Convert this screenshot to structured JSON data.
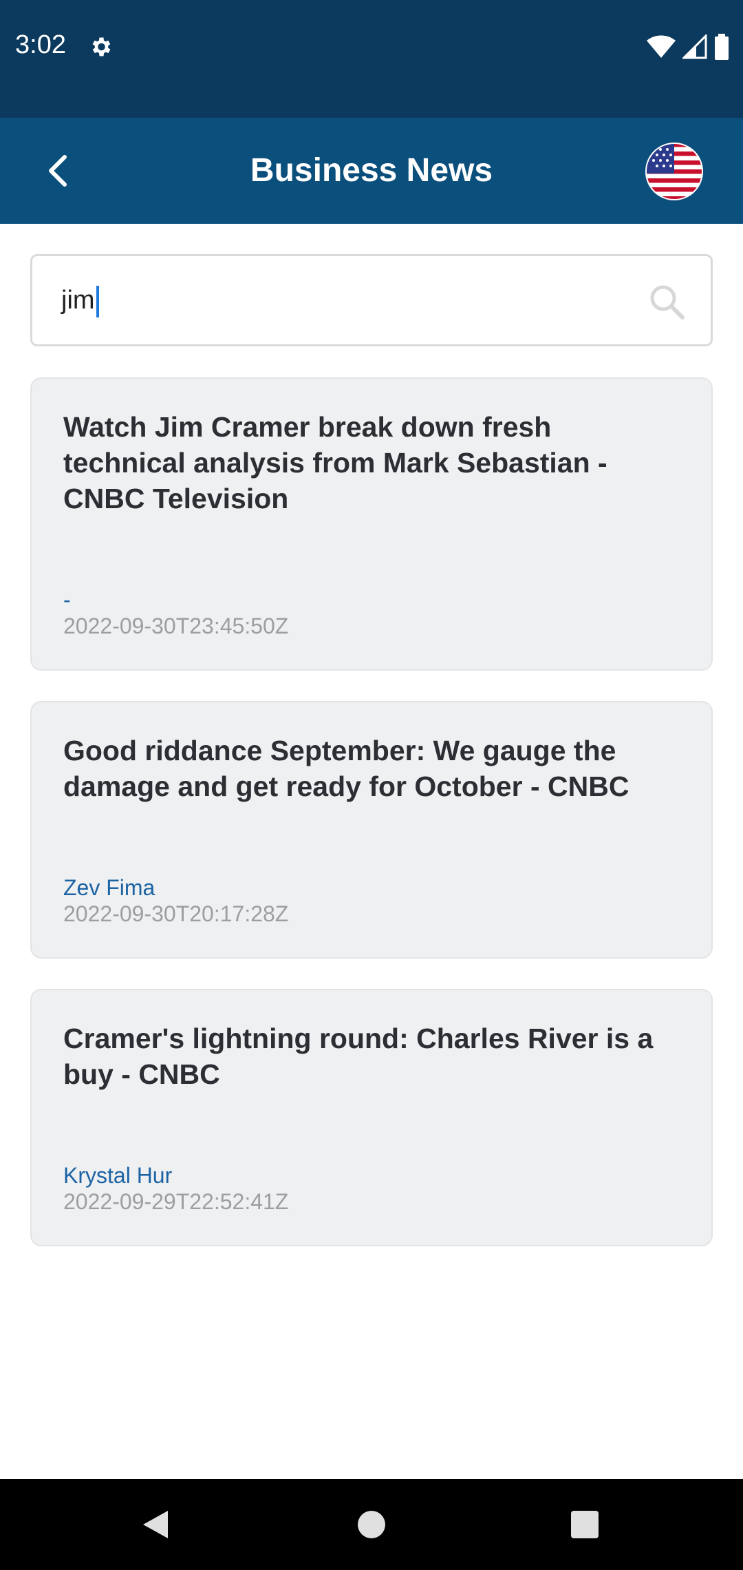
{
  "status_bar": {
    "time": "3:02",
    "left_icons": [
      "gear-icon"
    ],
    "right_icons": [
      "wifi-icon",
      "cellular-signal-icon",
      "battery-icon"
    ]
  },
  "app_bar": {
    "title": "Business News",
    "back_icon": "back-arrow-icon",
    "region_icon": "us-flag-icon"
  },
  "search": {
    "value": "jim",
    "icon": "search-icon"
  },
  "articles": [
    {
      "title": "Watch Jim Cramer break down fresh technical analysis from Mark Sebastian - CNBC Television",
      "author": "-",
      "date": "2022-09-30T23:45:50Z"
    },
    {
      "title": "Good riddance September: We gauge the damage and get ready for October - CNBC",
      "author": "Zev Fima",
      "date": "2022-09-30T20:17:28Z"
    },
    {
      "title": "Cramer's lightning round: Charles River is a buy - CNBC",
      "author": "Krystal Hur",
      "date": "2022-09-29T22:52:41Z"
    }
  ],
  "colors": {
    "status_bar": "#0b3a5e",
    "app_bar": "#0b4f7c",
    "card_background": "#eff0f2",
    "author_link": "#1c63a3",
    "date_text": "#9c9ea2"
  },
  "nav_bar": {
    "icons": [
      "nav-back-icon",
      "nav-home-icon",
      "nav-recents-icon"
    ]
  }
}
